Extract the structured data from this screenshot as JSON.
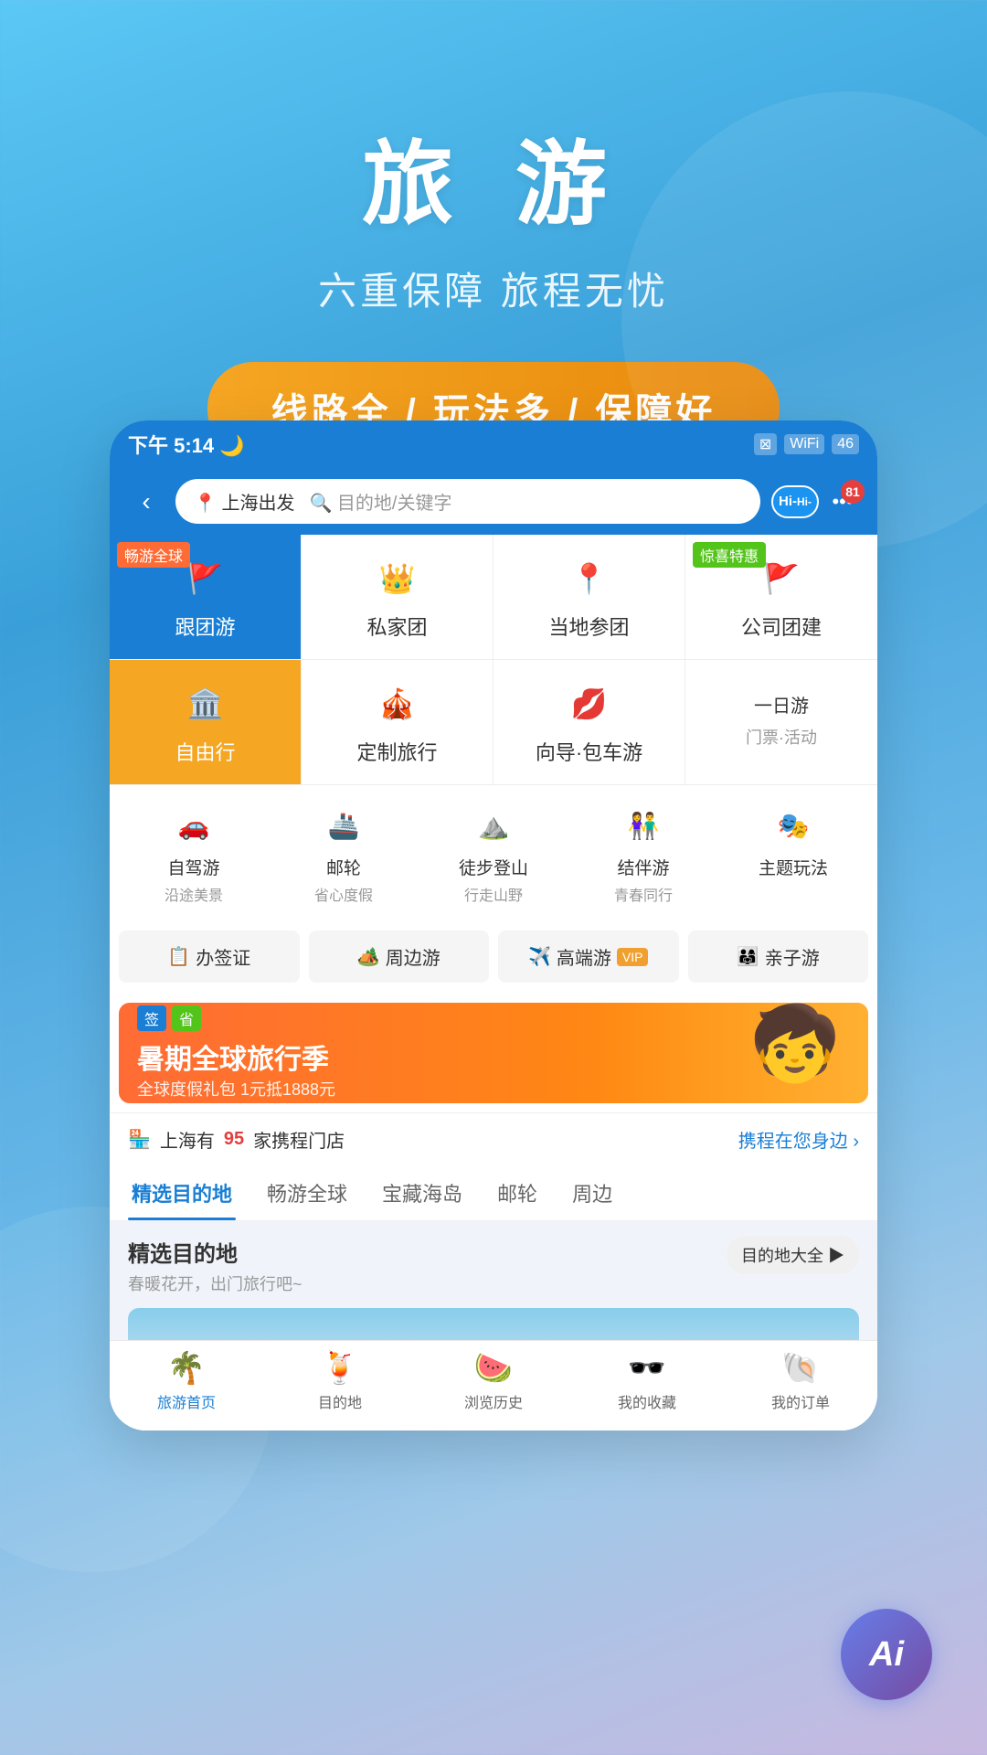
{
  "hero": {
    "title": "旅 游",
    "subtitle": "六重保障 旅程无忧",
    "badge": "线路全 / 玩法多 / 保障好"
  },
  "statusBar": {
    "time": "下午 5:14",
    "moonIcon": "🌙",
    "battery": "46"
  },
  "navBar": {
    "backIcon": "‹",
    "searchOrigin": "📍 上海出发",
    "searchPlaceholder": "🔍 目的地/关键字",
    "hiLabel": "Hi-",
    "notifCount": "81"
  },
  "categories": [
    {
      "id": "group-tour",
      "label": "跟团游",
      "icon": "🚩",
      "bg": "blue",
      "tag": "畅游全球",
      "tagColor": "orange"
    },
    {
      "id": "private-tour",
      "label": "私家团",
      "icon": "👑",
      "bg": "white",
      "tag": null
    },
    {
      "id": "local-tour",
      "label": "当地参团",
      "icon": "📍",
      "bg": "white",
      "tag": null
    },
    {
      "id": "company-tour",
      "label": "公司团建",
      "icon": "🚩",
      "bg": "white",
      "tag": "惊喜特惠",
      "tagColor": "green"
    }
  ],
  "categories2": [
    {
      "id": "free-tour",
      "label": "自由行",
      "icon": "🏛️",
      "bg": "orange",
      "tag": null
    },
    {
      "id": "custom-tour",
      "label": "定制旅行",
      "icon": "🎪",
      "bg": "white",
      "tag": null
    },
    {
      "id": "guide-tour",
      "label": "向导·包车游",
      "icon": "💋",
      "bg": "white",
      "tag": null
    },
    {
      "id": "day-tour",
      "label": "一日游",
      "icon": null,
      "bg": "white",
      "sub": "门票·活动",
      "tag": null
    }
  ],
  "activities": [
    {
      "id": "self-drive",
      "label": "自驾游",
      "sub": "沿途美景",
      "icon": "🚗"
    },
    {
      "id": "cruise",
      "label": "邮轮",
      "sub": "省心度假",
      "icon": "🚢"
    },
    {
      "id": "hiking",
      "label": "徒步登山",
      "sub": "行走山野",
      "icon": "⛰️"
    },
    {
      "id": "companion",
      "label": "结伴游",
      "sub": "青春同行",
      "icon": "👫"
    },
    {
      "id": "theme",
      "label": "主题玩法",
      "icon": "🎭"
    }
  ],
  "services": [
    {
      "id": "visa",
      "label": "办签证",
      "icon": "📋"
    },
    {
      "id": "nearby",
      "label": "周边游",
      "icon": "🏕️"
    },
    {
      "id": "luxury",
      "label": "高端游",
      "badge": "VIP",
      "icon": "✈️"
    },
    {
      "id": "family",
      "label": "亲子游",
      "icon": "👨‍👩‍👧"
    }
  ],
  "banner": {
    "tag1": "签",
    "tag2": "省",
    "mainText": "暑期全球旅行季",
    "subText": "全球度假礼包 1元抵1888元"
  },
  "storeInfo": {
    "prefix": "上海有",
    "count": "95",
    "suffix": "家携程门店",
    "link": "携程在您身边 ›"
  },
  "tabs": [
    {
      "id": "featured",
      "label": "精选目的地",
      "active": true
    },
    {
      "id": "world",
      "label": "畅游全球",
      "active": false
    },
    {
      "id": "island",
      "label": "宝藏海岛",
      "active": false
    },
    {
      "id": "cruise",
      "label": "邮轮",
      "active": false
    },
    {
      "id": "nearby",
      "label": "周边",
      "active": false
    }
  ],
  "featuredSection": {
    "title": "精选目的地",
    "subtitle": "春暖花开，出门旅行吧~",
    "linkText": "目的地大全 ▶"
  },
  "bottomNav": [
    {
      "id": "home",
      "label": "旅游首页",
      "icon": "🌴",
      "active": true
    },
    {
      "id": "destination",
      "label": "目的地",
      "icon": "🍹",
      "active": false
    },
    {
      "id": "history",
      "label": "浏览历史",
      "icon": "🍉",
      "active": false
    },
    {
      "id": "favorites",
      "label": "我的收藏",
      "icon": "🕶️",
      "active": false
    },
    {
      "id": "orders",
      "label": "我的订单",
      "icon": "🐚",
      "active": false
    }
  ]
}
